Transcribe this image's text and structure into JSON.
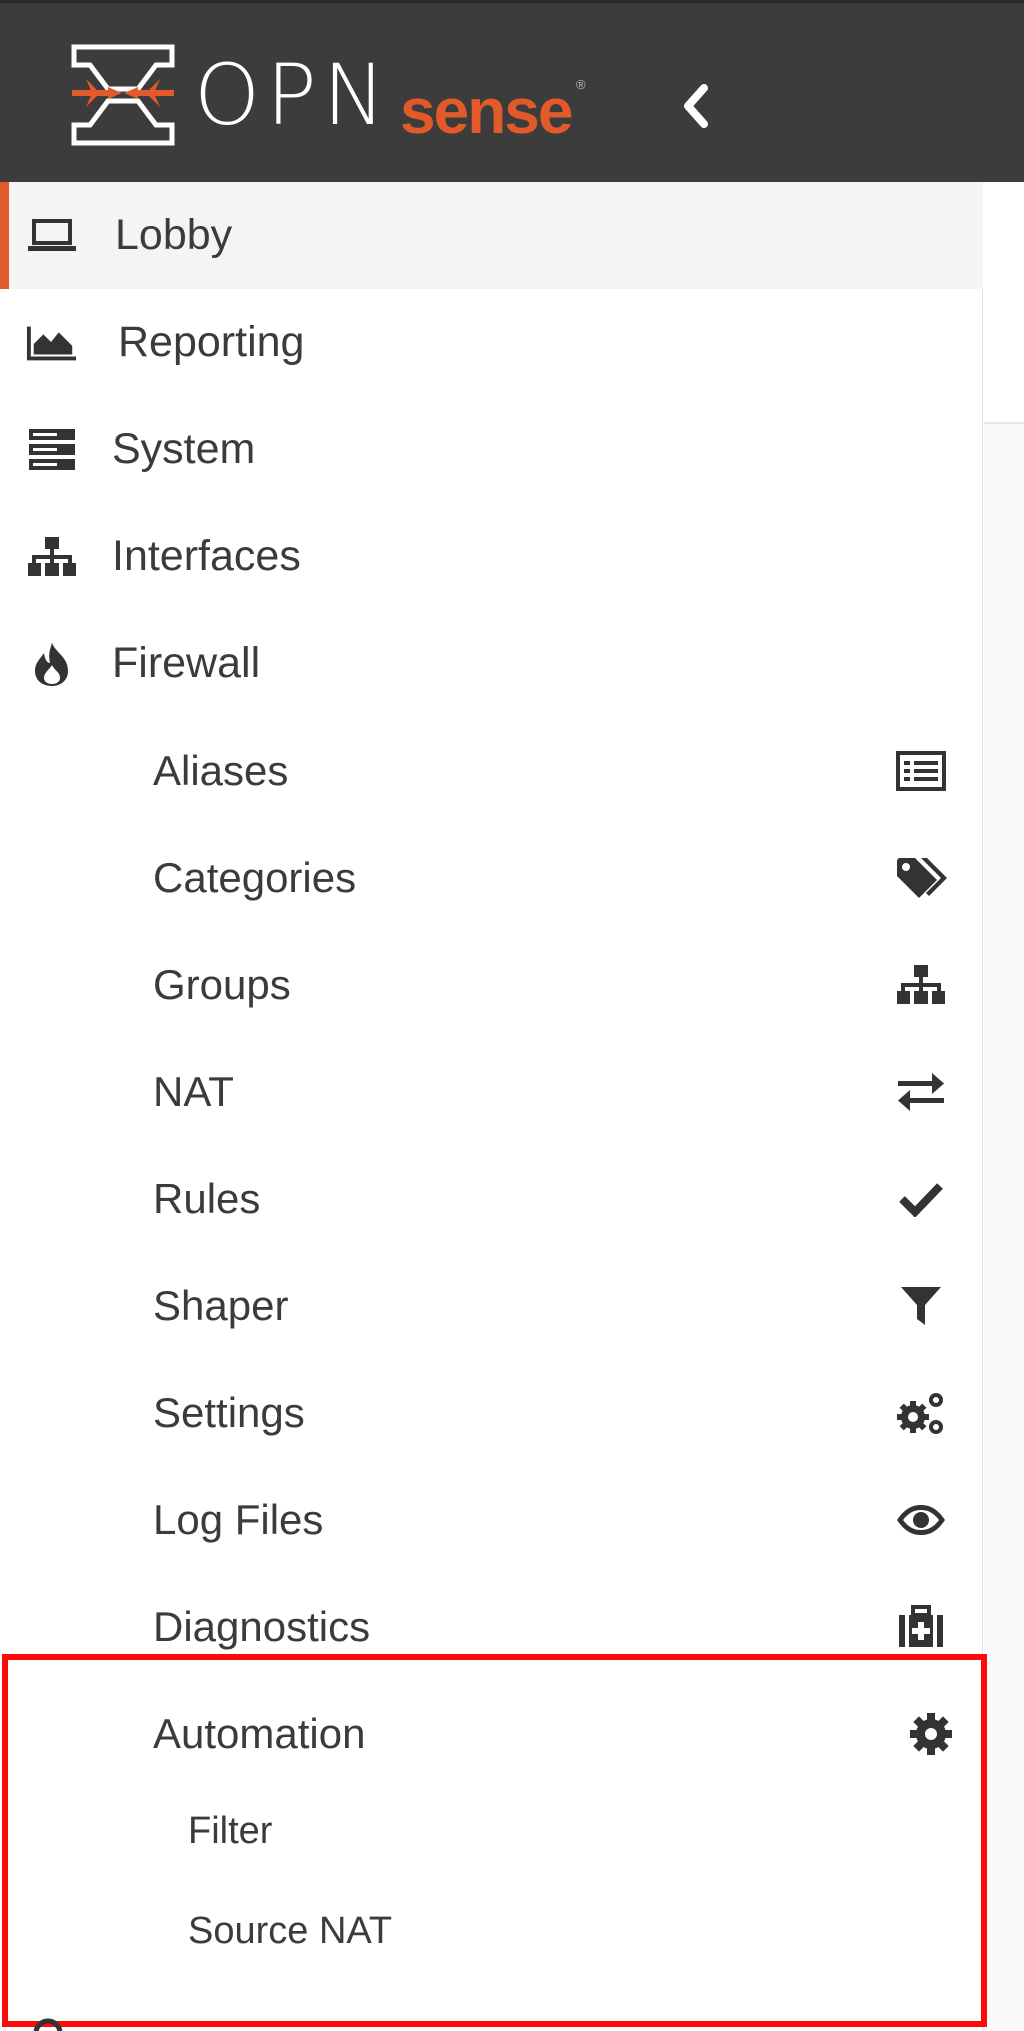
{
  "header": {
    "logo_opn": "OPN",
    "logo_sense": "sense",
    "logo_reg": "®",
    "collapse_icon": "chevron-left-icon"
  },
  "colors": {
    "brand_orange": "#e2592a",
    "header_bg": "#3c3c3c",
    "highlight_red": "#ff0a0a"
  },
  "menu": {
    "lobby": {
      "label": "Lobby",
      "icon": "laptop-icon",
      "active": true
    },
    "reporting": {
      "label": "Reporting",
      "icon": "area-chart-icon"
    },
    "system": {
      "label": "System",
      "icon": "server-icon"
    },
    "interfaces": {
      "label": "Interfaces",
      "icon": "sitemap-icon"
    },
    "firewall": {
      "label": "Firewall",
      "icon": "fire-icon",
      "items": [
        {
          "label": "Aliases",
          "icon": "list-alt-icon"
        },
        {
          "label": "Categories",
          "icon": "tags-icon"
        },
        {
          "label": "Groups",
          "icon": "sitemap-icon"
        },
        {
          "label": "NAT",
          "icon": "exchange-icon"
        },
        {
          "label": "Rules",
          "icon": "check-icon"
        },
        {
          "label": "Shaper",
          "icon": "filter-icon"
        },
        {
          "label": "Settings",
          "icon": "cogs-icon"
        },
        {
          "label": "Log Files",
          "icon": "eye-icon"
        },
        {
          "label": "Diagnostics",
          "icon": "medkit-icon"
        },
        {
          "label": "Automation",
          "icon": "cog-icon"
        }
      ],
      "automation_items": [
        {
          "label": "Filter"
        },
        {
          "label": "Source NAT"
        }
      ]
    }
  }
}
